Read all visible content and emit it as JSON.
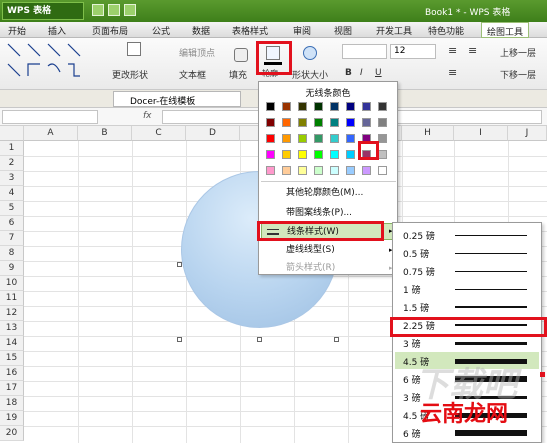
{
  "titlebar": {
    "app": "WPS 表格",
    "doc": "Book1 * - WPS 表格"
  },
  "menu": [
    "开始",
    "插入",
    "页面布局",
    "公式",
    "数据",
    "表格样式",
    "审阅",
    "视图",
    "开发工具",
    "特色功能",
    "绘图工具"
  ],
  "ribbon": {
    "edit_vertices": "编辑顶点",
    "change_shape": "更改形状",
    "textbox": "文本框",
    "fill": "填充",
    "outline": "轮廓",
    "shape_size": "形状大小",
    "font_size": "12",
    "bring_forward": "上移一层",
    "send_backward": "下移一层",
    "bold": "B",
    "italic": "I",
    "underline": "U"
  },
  "tabs": {
    "doc_tab": "Docer-在线模板"
  },
  "formula": {
    "fx": "fx"
  },
  "columns": [
    "A",
    "B",
    "C",
    "D",
    "E",
    "F",
    "G",
    "H",
    "I",
    "J"
  ],
  "rows": [
    "1",
    "2",
    "3",
    "4",
    "5",
    "6",
    "7",
    "8",
    "9",
    "10",
    "11",
    "12",
    "13",
    "14",
    "15",
    "16",
    "17",
    "18",
    "19",
    "20"
  ],
  "dropdown": {
    "no_line": "无线条颜色",
    "other_colors": "其他轮廓颜色(M)...",
    "pattern_line": "带图案线条(P)...",
    "line_style": "线条样式(W)",
    "dash_style": "虚线线型(S)",
    "arrow_style": "箭头样式(R)"
  },
  "submenu": [
    {
      "label": "0.25 磅",
      "weight": 0.25
    },
    {
      "label": "0.5 磅",
      "weight": 0.5
    },
    {
      "label": "0.75 磅",
      "weight": 0.75
    },
    {
      "label": "1 磅",
      "weight": 1
    },
    {
      "label": "1.5 磅",
      "weight": 1.5
    },
    {
      "label": "2.25 磅",
      "weight": 2.25
    },
    {
      "label": "3 磅",
      "weight": 3
    },
    {
      "label": "4.5 磅",
      "weight": 4.5
    },
    {
      "label": "6 磅",
      "weight": 6
    },
    {
      "label": "3 磅",
      "weight": 3
    },
    {
      "label": "4.5 磅",
      "weight": 4.5
    },
    {
      "label": "6 磅",
      "weight": 6
    }
  ],
  "watermark": "云南龙网",
  "watermark_bg": "下载吧",
  "colors": {
    "swatches": [
      [
        "#000000",
        "#993300",
        "#333300",
        "#003300",
        "#003366",
        "#000080",
        "#333399",
        "#333333"
      ],
      [
        "#800000",
        "#ff6600",
        "#808000",
        "#008000",
        "#008080",
        "#0000ff",
        "#666699",
        "#808080"
      ],
      [
        "#ff0000",
        "#ff9900",
        "#99cc00",
        "#339966",
        "#33cccc",
        "#3366ff",
        "#800080",
        "#969696"
      ],
      [
        "#ff00ff",
        "#ffcc00",
        "#ffff00",
        "#00ff00",
        "#00ffff",
        "#00ccff",
        "#993366",
        "#c0c0c0"
      ],
      [
        "#ff99cc",
        "#ffcc99",
        "#ffff99",
        "#ccffcc",
        "#ccffff",
        "#99ccff",
        "#cc99ff",
        "#ffffff"
      ]
    ]
  }
}
